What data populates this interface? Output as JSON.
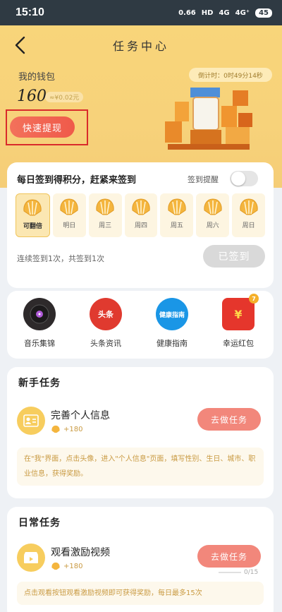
{
  "status_bar": {
    "time": "15:10",
    "network_speed": "0.66",
    "signal_1": "HD",
    "signal_2": "4G",
    "signal_3": "4G⁺",
    "battery": "45"
  },
  "header": {
    "title": "任务中心"
  },
  "wallet": {
    "label": "我的钱包",
    "amount": "160",
    "converted": "≈¥0.02元",
    "countdown": "倒计时：0时49分14秒",
    "cash_out_label": "快速提现"
  },
  "checkin": {
    "title": "每日签到得积分，赶紧来签到",
    "reminder_label": "签到提醒",
    "reminder_on": false,
    "days": [
      {
        "label": "可翻倍",
        "active": true
      },
      {
        "label": "明日",
        "active": false
      },
      {
        "label": "周三",
        "active": false
      },
      {
        "label": "周四",
        "active": false
      },
      {
        "label": "周五",
        "active": false
      },
      {
        "label": "周六",
        "active": false
      },
      {
        "label": "周日",
        "active": false
      }
    ],
    "streak_text": "连续签到1次，共签到1次",
    "signed_label": "已签到"
  },
  "shortcuts": [
    {
      "label": "音乐集锦",
      "icon": "music-disc-icon",
      "color": "#2e2a2b"
    },
    {
      "label": "头条资讯",
      "icon": "toutiao-icon",
      "color": "#e03a2f",
      "icon_text": "头条"
    },
    {
      "label": "健康指南",
      "icon": "health-guide-icon",
      "color": "#1a96e6",
      "icon_text": "健康指南"
    },
    {
      "label": "幸运红包",
      "icon": "red-envelope-icon",
      "color": "#e5362c",
      "icon_text": "¥",
      "badge": "7"
    }
  ],
  "newbie_tasks": {
    "title": "新手任务",
    "task": {
      "name": "完善个人信息",
      "reward": "+180",
      "action_label": "去做任务",
      "description": "在\"我\"界面，点击头像，进入\"个人信息\"页面，填写性别、生日、城市、职业信息，获得奖励。"
    }
  },
  "daily_tasks": {
    "title": "日常任务",
    "task": {
      "name": "观看激励视频",
      "reward": "+180",
      "action_label": "去做任务",
      "progress": "0/15",
      "description": "点击观看按钮观看激励视频即可获得奖励，每日最多15次"
    }
  },
  "colors": {
    "hero_yellow": "#f8d57a",
    "accent_red": "#ef5a4a",
    "task_button": "#f2877b",
    "reward_gold": "#c99a42"
  }
}
